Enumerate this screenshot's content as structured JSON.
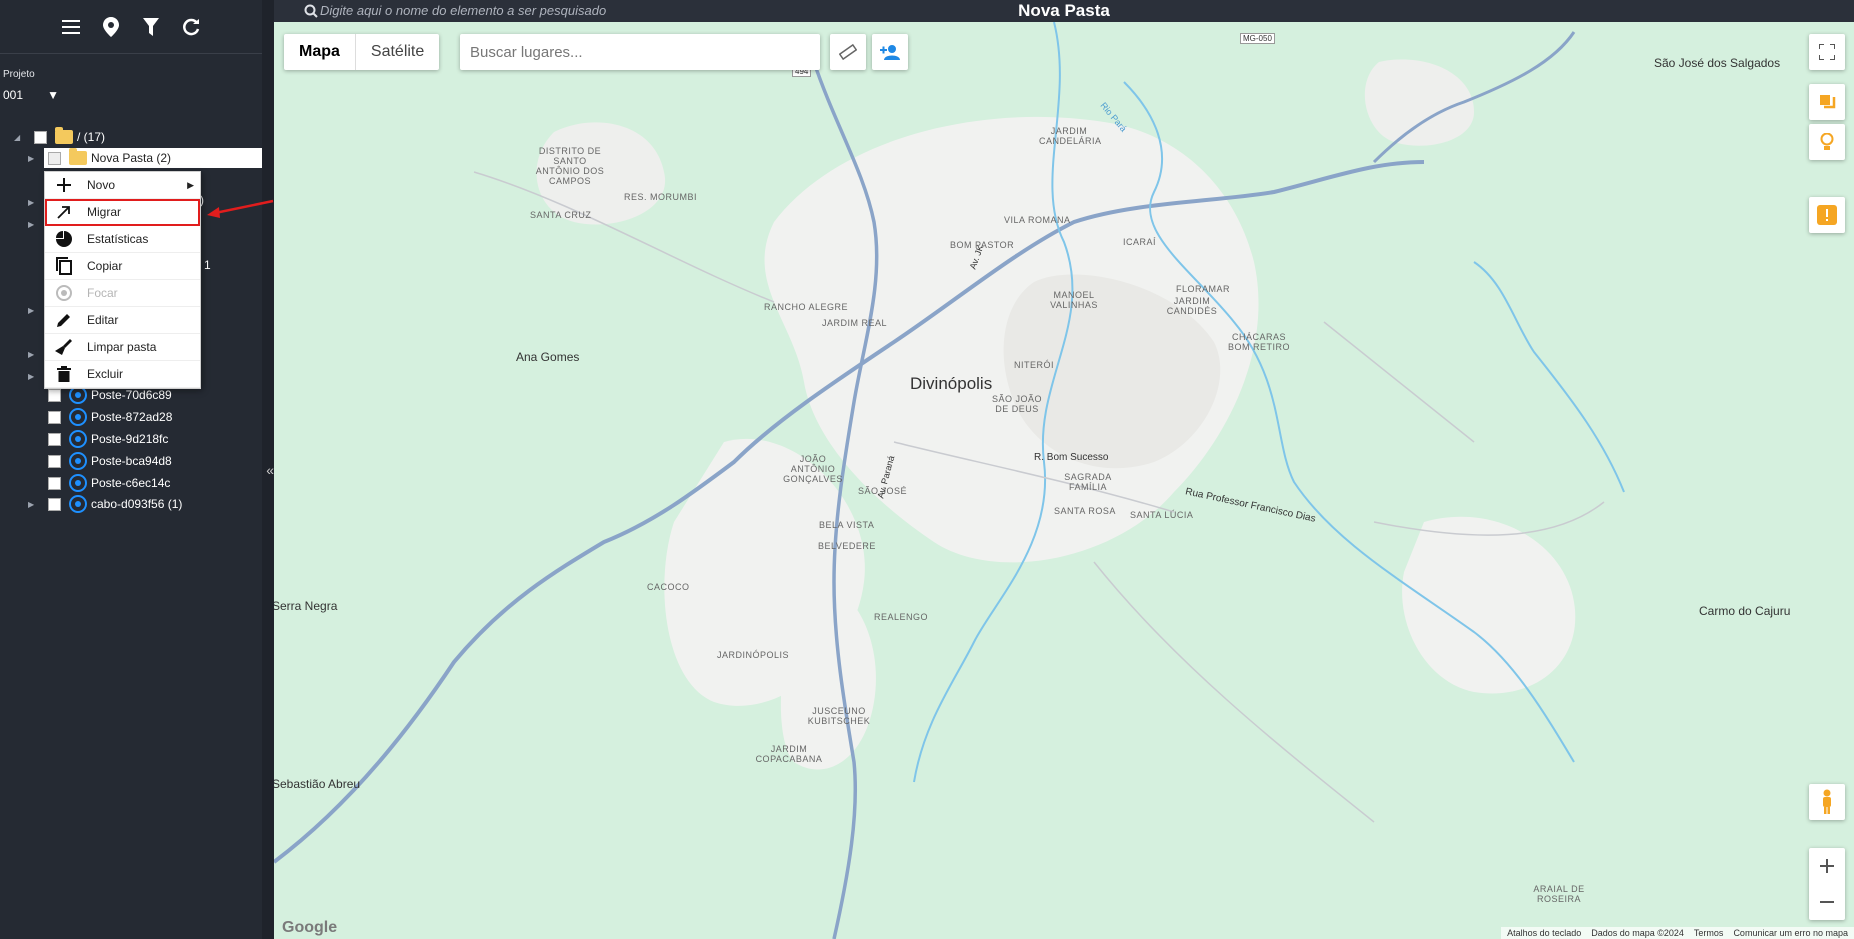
{
  "topbar": {
    "search_placeholder": "Digite aqui o nome do elemento a ser pesquisado",
    "title": "Nova Pasta"
  },
  "sidebar": {
    "project_label": "Projeto",
    "project_value": "001",
    "tree": {
      "root": "/ (17)",
      "selected": "Nova Pasta (2)",
      "items": [
        "Poste-70d6c89",
        "Poste-872ad28",
        "Poste-9d218fc",
        "Poste-bca94d8",
        "Poste-c6ec14c",
        "cabo-d093f56 (1)"
      ],
      "peek_1": ")",
      "peek_2": "1"
    }
  },
  "context_menu": {
    "items": [
      {
        "label": "Novo",
        "icon": "plus-icon",
        "submenu": true
      },
      {
        "label": "Migrar",
        "icon": "migrate-arrow-icon",
        "highlight": true
      },
      {
        "label": "Estatísticas",
        "icon": "pie-chart-icon"
      },
      {
        "label": "Copiar",
        "icon": "copy-icon"
      },
      {
        "label": "Focar",
        "icon": "focus-icon",
        "disabled": true
      },
      {
        "label": "Editar",
        "icon": "pencil-icon"
      },
      {
        "label": "Limpar pasta",
        "icon": "broom-icon"
      },
      {
        "label": "Excluir",
        "icon": "trash-icon"
      }
    ]
  },
  "map": {
    "type_buttons": [
      "Mapa",
      "Satélite"
    ],
    "places_placeholder": "Buscar lugares...",
    "city": "Divinópolis",
    "towns": [
      "Ana Gomes",
      "Carmo do Cajuru",
      "São José dos Salgados",
      "Sebastião Abreu",
      "Serra Negra"
    ],
    "neighborhoods": [
      "Distrito de Santo Antônio dos Campos",
      "Res. Morumbi",
      "Santa Cruz",
      "Jardim Candelária",
      "Vila Romana",
      "Bom Pastor",
      "Icaraí",
      "Manoel Valinhas",
      "Floramar",
      "Jardim Candidés",
      "Chácaras Bom Retiro",
      "Rancho Alegre",
      "Jardim Real",
      "Niterói",
      "São João de Deus",
      "João Antônio Gonçalves",
      "São José",
      "Sagrada Família",
      "Bela Vista",
      "Belvedere",
      "Santa Rosa",
      "Santa Lúcia",
      "Cacoco",
      "Realengo",
      "Jardinópolis",
      "Jusceuno Kubitschek",
      "Jardim Copacabana",
      "Araial de Roseira"
    ],
    "roads": [
      "MG-050",
      "494",
      "R. Bom Sucesso",
      "Rua Professor Francisco Dias",
      "Av. JK",
      "Av. Paraná",
      "Rio Pará"
    ],
    "footer": [
      "Atalhos do teclado",
      "Dados do mapa ©2024",
      "Termos",
      "Comunicar um erro no mapa"
    ],
    "logo": "Google"
  },
  "colors": {
    "sidebar_bg": "#252a33",
    "map_bg": "#d5f0de",
    "highlight_red": "#e11d1d",
    "warning_orange": "#f5a623"
  }
}
